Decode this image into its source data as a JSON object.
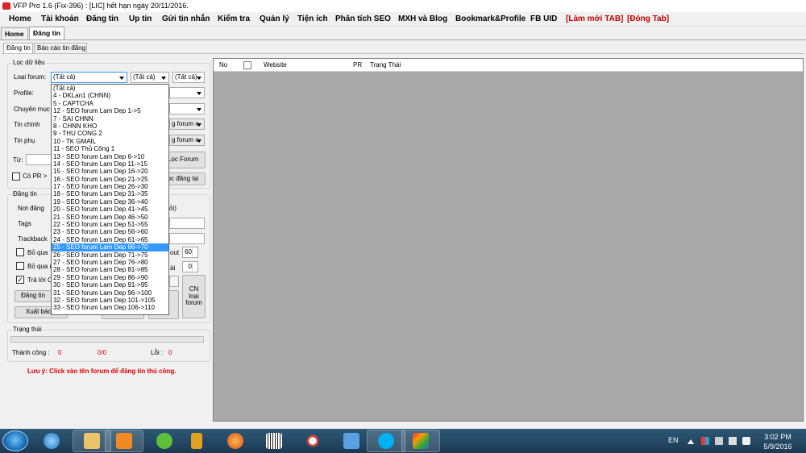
{
  "window": {
    "title": "VFP Pro 1.6 (Fix-396) : [LIC] hết hạn ngày 20/11/2016."
  },
  "menu": {
    "items": [
      {
        "label": "Home",
        "red": false
      },
      {
        "label": "Tài khoản",
        "red": false
      },
      {
        "label": "Đăng tin",
        "red": false
      },
      {
        "label": "Up tin",
        "red": false
      },
      {
        "label": "Gửi tin nhắn",
        "red": false
      },
      {
        "label": "Kiểm tra",
        "red": false
      },
      {
        "label": "Quản lý",
        "red": false
      },
      {
        "label": "Tiện ích",
        "red": false
      },
      {
        "label": "Phân tích SEO",
        "red": false
      },
      {
        "label": "MXH và Blog",
        "red": false
      },
      {
        "label": "Bookmark&Profile",
        "red": false
      },
      {
        "label": "FB UID",
        "red": false
      },
      {
        "label": "[Làm mới TAB]",
        "red": true
      },
      {
        "label": "[Đóng Tab]",
        "red": true
      }
    ]
  },
  "tabs": {
    "home": "Home",
    "dang_tin": "Đăng tin"
  },
  "subtabs": {
    "dang_tin": "Đăng tin",
    "bao_cao": "Báo cáo tin đăng"
  },
  "filter": {
    "group_title": "Lọc dữ liệu",
    "loai_forum_label": "Loại forum:",
    "loai_forum_value": "(Tất cả)",
    "combo2_value": "(Tất cả)",
    "combo3_value": "(Tất cả)",
    "profile_label": "Profile:",
    "chuyen_muc_label": "Chuyên mục",
    "tin_chinh_label": "Tin chính",
    "tin_chinh_value": "g forum c",
    "tin_phu_label": "Tin phụ",
    "tin_phu_value": "g forum c",
    "tu_label": "Từ:",
    "loc_forum_button": "Lọc Forum",
    "co_pr_label": "Có PR >",
    "loc_dang_lai_button": "ọc đăng lại"
  },
  "dropdown": {
    "selected_index": 25,
    "items": [
      "(Tất cả)",
      "4 - DKLan1 (CHNN)",
      "5 - CAPTCHA",
      "12 - SEO forum Lam Dep 1->5",
      "7 - SAI CHNN",
      "8 - CHNN KHO",
      "9 - THU CONG 2",
      "10 - TK GMAIL",
      "11 - SEO Thủ Công 1",
      "13 - SEO forum Lam Dep 6->10",
      "14 - SEO forum Lam Dep 11->15",
      "15 - SEO forum Lam Dep 16->20",
      "16 - SEO forum Lam Dep 21->25",
      "17 - SEO forum Lam Dep 26->30",
      "18 - SEO forum Lam Dep 31->35",
      "19 - SEO forum Lam Dep 36->40",
      "20 - SEO forum Lam Dep 41->45",
      "21 - SEO forum Lam Dep 46->50",
      "22 - SEO forum Lam Dep 51->55",
      "23 - SEO forum Lam Dep 56->60",
      "24 - SEO forum Lam Dep 61->65",
      "25 - SEO forum Lam Dep 66->70",
      "26 - SEO forum Lam Dep 71->75",
      "27 - SEO forum Lam Dep 76->80",
      "28 - SEO forum Lam Dep 81->85",
      "29 - SEO forum Lam Dep 86->90",
      "30 - SEO forum Lam Dep 91->95",
      "31 - SEO forum Lam Dep 96->100",
      "32 - SEO forum Lam Dep 101->105",
      "33 - SEO forum Lam Dep 106->110"
    ]
  },
  "post": {
    "group_title": "Đăng tin",
    "noi_dang_label": "Nơi đăng",
    "noi_dang_suffix": "ỏi)",
    "tags_label": "Tags",
    "trackback_label": "Trackback",
    "bo_qua_1": "Bỏ qua",
    "bo_qua_2": "Bỏ qua (",
    "tra_loi": "Trả lời C",
    "timeout_label": "out",
    "timeout_value": "60",
    "lai_label": "ài",
    "lai_value": "0",
    "dang_tin_button": "Đăng tin",
    "xuat_bao_button": "Xuất báo c",
    "cn_loai_forum_button": "CN loại forum",
    "partial_button": "n"
  },
  "status": {
    "group_title": "Trạng thái",
    "thanh_cong_label": "Thành công :",
    "thanh_cong_value": "0",
    "ratio": "0/0",
    "loi_label": "Lỗi :",
    "loi_value": "0",
    "note": "Lưu ý: Click vào tên forum để đăng tin thủ công."
  },
  "grid": {
    "headers": {
      "no": "No",
      "website": "Website",
      "pr": "PR",
      "trang_thai": "Trạng Thái"
    }
  },
  "taskbar": {
    "lang": "EN",
    "time": "3:02 PM",
    "date": "5/9/2016"
  }
}
